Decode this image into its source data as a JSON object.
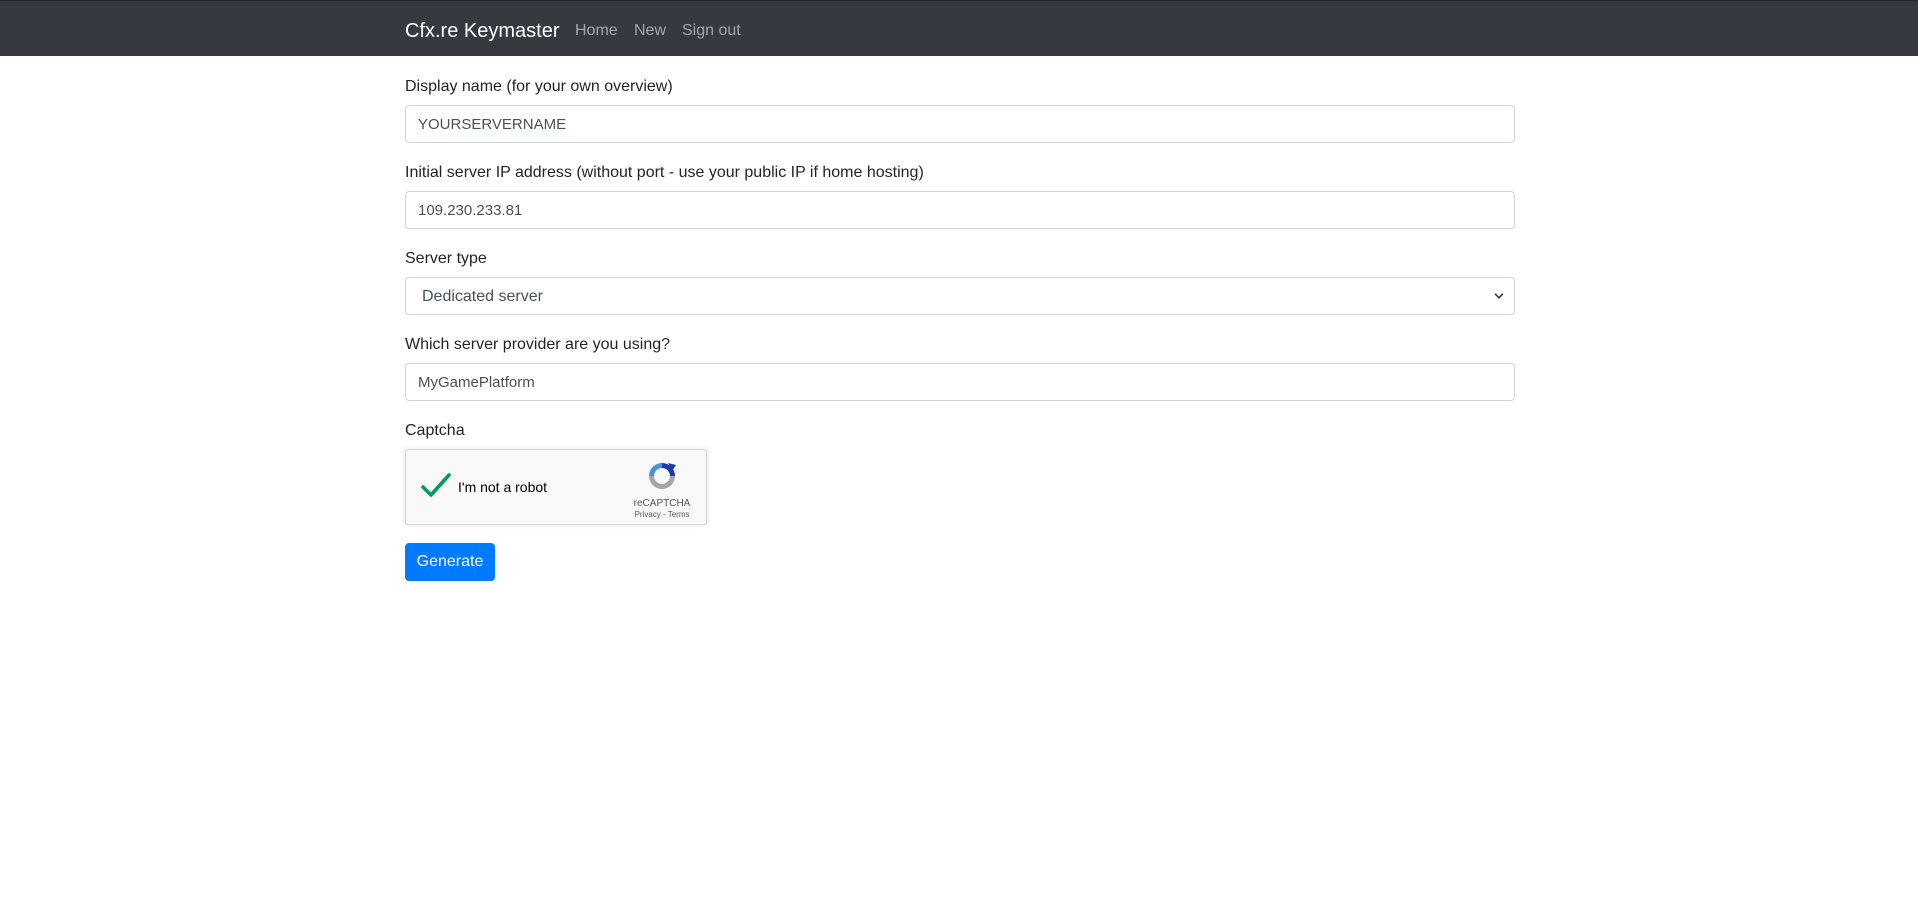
{
  "navbar": {
    "brand": "Cfx.re Keymaster",
    "links": [
      "Home",
      "New",
      "Sign out"
    ]
  },
  "form": {
    "display_name": {
      "label": "Display name (for your own overview)",
      "value": "YOURSERVERNAME"
    },
    "server_ip": {
      "label": "Initial server IP address (without port - use your public IP if home hosting)",
      "value": "109.230.233.81"
    },
    "server_type": {
      "label": "Server type",
      "selected": "Dedicated server"
    },
    "server_provider": {
      "label": "Which server provider are you using?",
      "value": "MyGamePlatform"
    },
    "captcha": {
      "label": "Captcha",
      "checkbox_text": "I'm not a robot",
      "brand": "reCAPTCHA",
      "privacy": "Privacy",
      "separator": " - ",
      "terms": "Terms",
      "checked": true
    },
    "submit_label": "Generate"
  },
  "colors": {
    "navbar_bg": "#343a40",
    "primary": "#007bff",
    "check_green": "#009e55"
  }
}
